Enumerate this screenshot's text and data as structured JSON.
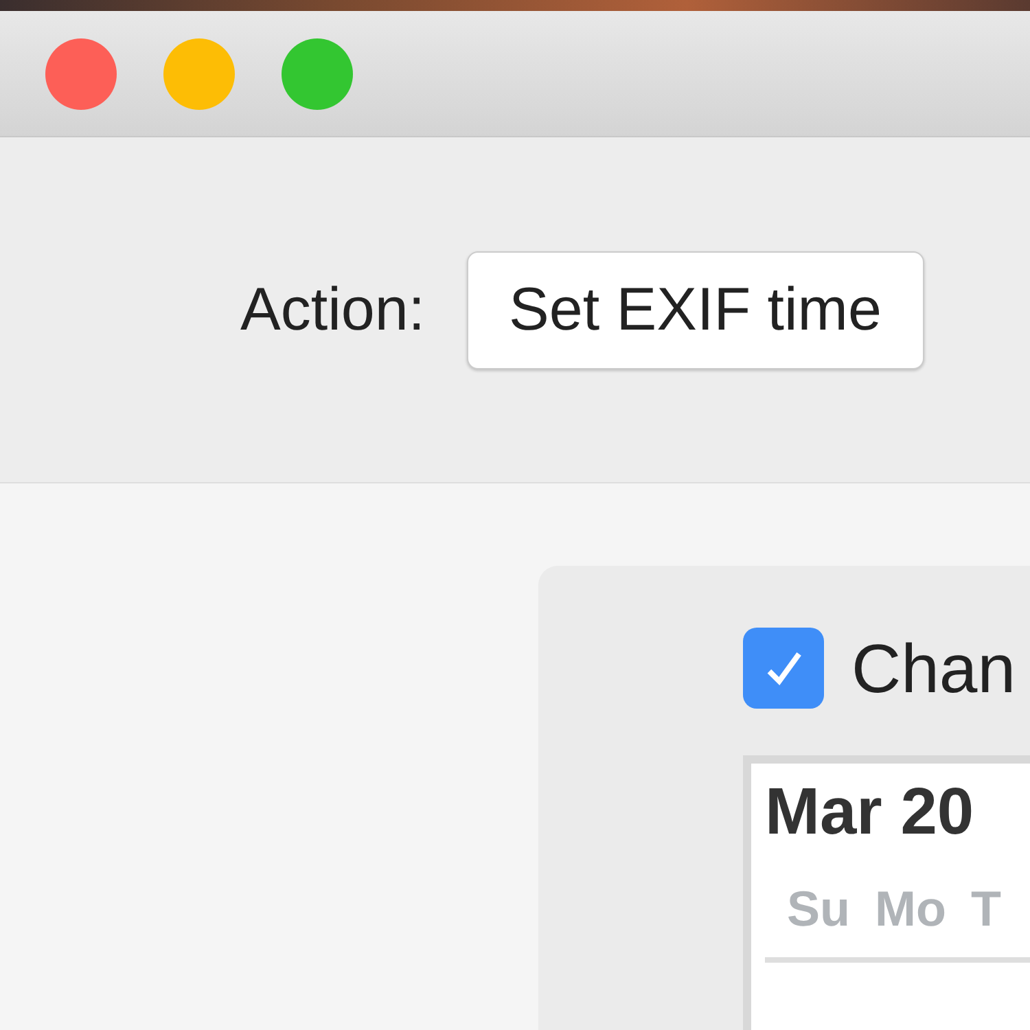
{
  "toolbar": {
    "label": "Action:",
    "popup_value": "Set EXIF time"
  },
  "panel": {
    "checkbox": {
      "label": "Chan",
      "checked": true
    },
    "calendar": {
      "month": "Mar 20",
      "weekdays": [
        "Su",
        "Mo",
        "T"
      ]
    }
  }
}
